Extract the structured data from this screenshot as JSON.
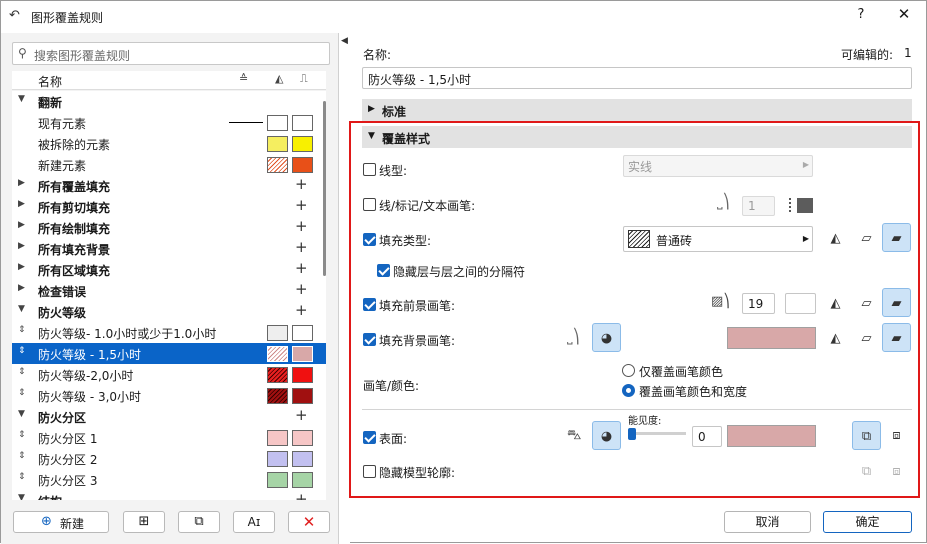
{
  "window": {
    "title": "图形覆盖规则",
    "help": "?",
    "close": "✕"
  },
  "search": {
    "placeholder": "搜索图形覆盖规则"
  },
  "list_header": {
    "name": "名称"
  },
  "rows": [
    {
      "label": "翻新",
      "kind": "group",
      "open": true
    },
    {
      "label": "现有元素",
      "kind": "item"
    },
    {
      "label": "被拆除的元素",
      "kind": "item"
    },
    {
      "label": "新建元素",
      "kind": "item"
    },
    {
      "label": "所有覆盖填充",
      "kind": "group"
    },
    {
      "label": "所有剪切填充",
      "kind": "group"
    },
    {
      "label": "所有绘制填充",
      "kind": "group"
    },
    {
      "label": "所有填充背景",
      "kind": "group"
    },
    {
      "label": "所有区域填充",
      "kind": "group"
    },
    {
      "label": "检查错误",
      "kind": "group"
    },
    {
      "label": "防火等级",
      "kind": "group",
      "open": true
    },
    {
      "label": "防火等级- 1.0小时或少于1.0小时",
      "kind": "sub"
    },
    {
      "label": "防火等级 - 1,5小时",
      "kind": "sub",
      "selected": true
    },
    {
      "label": "防火等级-2,0小时",
      "kind": "sub"
    },
    {
      "label": "防火等级 - 3,0小时",
      "kind": "sub"
    },
    {
      "label": "防火分区",
      "kind": "group",
      "open": true
    },
    {
      "label": "防火分区 1",
      "kind": "sub"
    },
    {
      "label": "防火分区 2",
      "kind": "sub"
    },
    {
      "label": "防火分区 3",
      "kind": "sub"
    },
    {
      "label": "结构",
      "kind": "group",
      "open": true
    }
  ],
  "bottom_buttons": {
    "new": "新建"
  },
  "right": {
    "name_label": "名称:",
    "editable_label": "可编辑的:",
    "editable_count": "1",
    "name_value": "防火等级 - 1,5小时",
    "section_standard": "标准",
    "section_override": "覆盖样式",
    "linetype_label": "线型:",
    "linetype_value": "实线",
    "pen_label": "线/标记/文本画笔:",
    "pen_value": "1",
    "filltype_label": "填充类型:",
    "filltype_value": "普通砖",
    "hide_sep_label": "隐藏层与层之间的分隔符",
    "fg_pen_label": "填充前景画笔:",
    "fg_pen_value": "19",
    "bg_pen_label": "填充背景画笔:",
    "pen_color_label": "画笔/颜色:",
    "radio_color_only": "仅覆盖画笔颜色",
    "radio_color_width": "覆盖画笔颜色和宽度",
    "surface_label": "表面:",
    "transparency_label": "能见度:",
    "transparency_value": "0",
    "hide_contour_label": "隐藏模型轮廓:"
  },
  "footer": {
    "cancel": "取消",
    "ok": "确定"
  },
  "colors": {
    "accent": "#1465c0",
    "selection": "#0a64c8",
    "highlight_border": "#e01818",
    "surface_pink": "#d8a8a8"
  }
}
